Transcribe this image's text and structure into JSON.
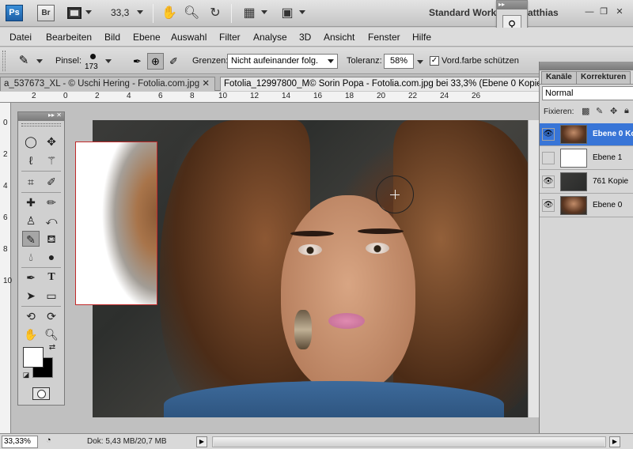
{
  "appbar": {
    "ps_label": "Ps",
    "br_label": "Br",
    "zoom": "33,3",
    "workspace": "Standard Work",
    "user": "atthias"
  },
  "menu": [
    "Datei",
    "Bearbeiten",
    "Bild",
    "Ebene",
    "Auswahl",
    "Filter",
    "Analyse",
    "3D",
    "Ansicht",
    "Fenster",
    "Hilfe"
  ],
  "options": {
    "brush_label": "Pinsel:",
    "brush_size": "173",
    "limits_label": "Grenzen:",
    "limits_value": "Nicht aufeinander folg.",
    "tolerance_label": "Toleranz:",
    "tolerance_value": "58%",
    "protect_label": "Vord.farbe schützen",
    "protect_checked": "✓"
  },
  "tabs": [
    {
      "label": "a_537673_XL - © Uschi Hering - Fotolia.com.jpg"
    },
    {
      "label": "Fotolia_12997800_M© Sorin Popa - Fotolia.com.jpg bei 33,3% (Ebene 0 Kopie"
    }
  ],
  "ruler_h": [
    "2",
    "0",
    "2",
    "4",
    "6",
    "8",
    "10",
    "12",
    "14",
    "16",
    "18",
    "20",
    "22",
    "24",
    "26"
  ],
  "ruler_v": [
    "0",
    "2",
    "4",
    "6",
    "8",
    "10"
  ],
  "layers_panel": {
    "tab_channels": "Kanäle",
    "tab_corrections": "Korrekturen",
    "blend_mode": "Normal",
    "lock_label": "Fixieren:",
    "layers": [
      {
        "name": "Ebene 0 Ko",
        "visible": true,
        "selected": true
      },
      {
        "name": "Ebene 1",
        "visible": false,
        "selected": false
      },
      {
        "name": "761 Kopie",
        "visible": true,
        "selected": false
      },
      {
        "name": "Ebene 0",
        "visible": true,
        "selected": false
      }
    ]
  },
  "status": {
    "zoom": "33,33%",
    "doc": "Dok: 5,43 MB/20,7 MB"
  }
}
